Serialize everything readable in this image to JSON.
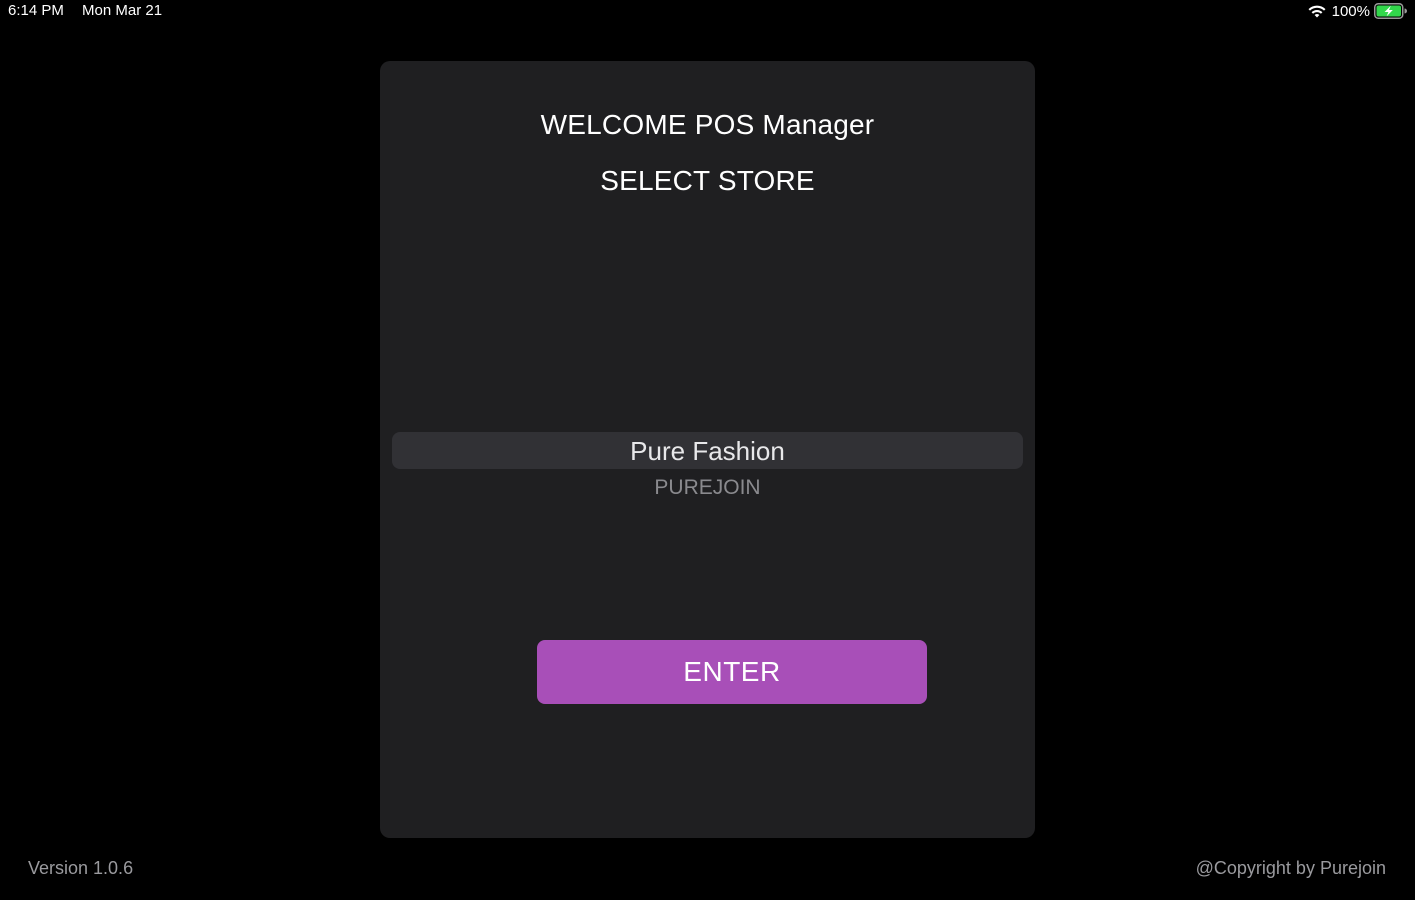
{
  "status_bar": {
    "time": "6:14 PM",
    "date": "Mon Mar 21",
    "battery_percent": "100%",
    "wifi_icon": "wifi-icon",
    "battery_icon": "battery-charging-icon",
    "battery_color": "#32d74b"
  },
  "card": {
    "welcome_title": "WELCOME POS Manager",
    "select_title": "SELECT STORE",
    "store_picker": {
      "selected": "Pure Fashion",
      "options": [
        "Pure Fashion",
        "PUREJOIN"
      ]
    },
    "enter_label": "ENTER"
  },
  "footer": {
    "version": "Version 1.0.6",
    "copyright": "@Copyright by Purejoin"
  },
  "colors": {
    "background": "#000000",
    "card": "#1f1f21",
    "accent": "#a84fb8",
    "picker_highlight": "#313135"
  }
}
